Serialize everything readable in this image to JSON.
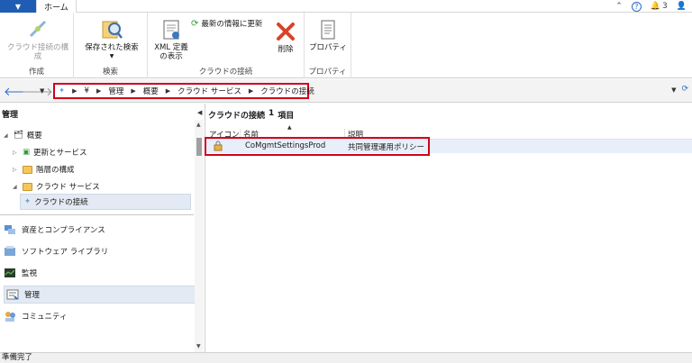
{
  "titlebar": {
    "file_label": "▼",
    "home_tab": "ホーム",
    "notification_count": "3",
    "help": "?"
  },
  "ribbon": {
    "groups": [
      {
        "label": "作成",
        "buttons": [
          {
            "label": "クラウド接続の構成",
            "disabled": true
          }
        ]
      },
      {
        "label": "検索",
        "buttons": [
          {
            "label": "保存された検索",
            "has_dropdown": true
          }
        ]
      },
      {
        "label": "クラウドの接続",
        "buttons": [
          {
            "label": "XML 定義の表示"
          },
          {
            "label": "最新の情報に更新"
          },
          {
            "label": "削除"
          }
        ]
      },
      {
        "label": "プロパティ",
        "buttons": [
          {
            "label": "プロパティ"
          }
        ]
      }
    ]
  },
  "address": {
    "crumbs": [
      "¥",
      "管理",
      "概要",
      "クラウド サービス",
      "クラウドの接続"
    ]
  },
  "left_pane": {
    "title": "管理",
    "tree": [
      {
        "label": "概要"
      },
      {
        "label": "更新とサービス"
      },
      {
        "label": "階層の構成"
      },
      {
        "label": "クラウド サービス"
      },
      {
        "label": "クラウドの接続"
      }
    ],
    "workspaces": [
      {
        "label": "資産とコンプライアンス"
      },
      {
        "label": "ソフトウェア ライブラリ"
      },
      {
        "label": "監視"
      },
      {
        "label": "管理"
      },
      {
        "label": "コミュニティ"
      }
    ]
  },
  "right_pane": {
    "title": "クラウドの接続",
    "count": "1",
    "count_suffix": "項目",
    "columns": [
      "アイコン",
      "名前",
      "説明"
    ],
    "rows": [
      {
        "name": "CoMgmtSettingsProd",
        "description": "共同管理運用ポリシー"
      }
    ]
  },
  "status": {
    "text": "準備完了"
  },
  "colors": {
    "accent": "#1e5db3",
    "highlight_box": "#d0021b",
    "selection": "#e8effa"
  }
}
